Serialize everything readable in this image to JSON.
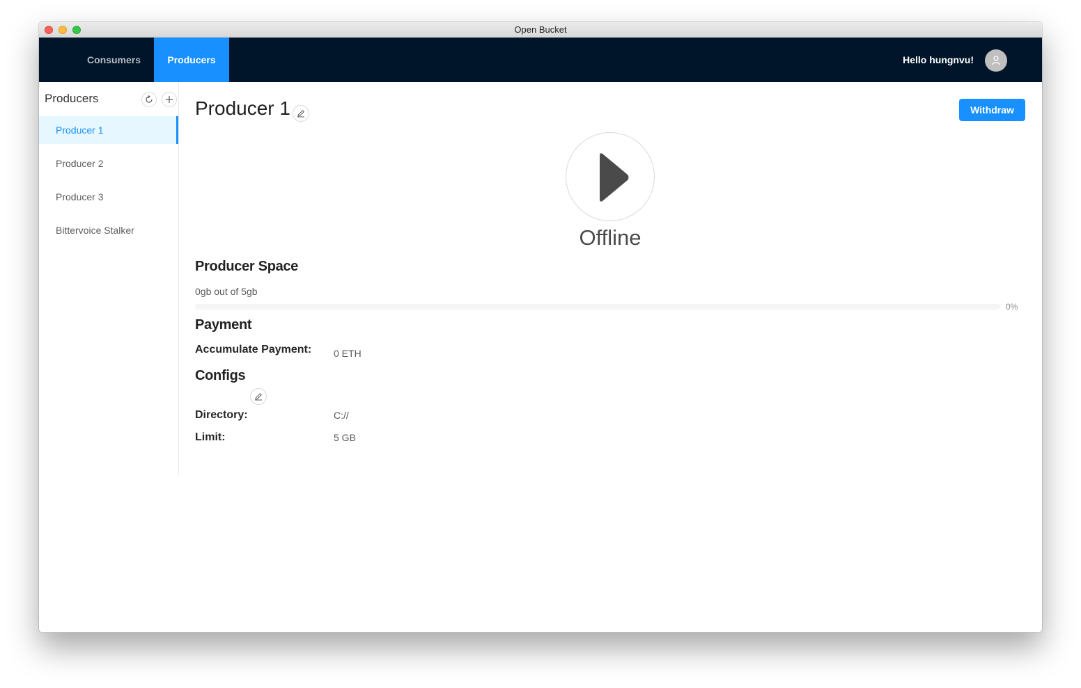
{
  "window": {
    "title": "Open Bucket"
  },
  "navbar": {
    "tabs": [
      {
        "label": "Consumers"
      },
      {
        "label": "Producers"
      }
    ],
    "greeting": "Hello hungnvu!"
  },
  "sidebar": {
    "title": "Producers",
    "items": [
      {
        "label": "Producer 1"
      },
      {
        "label": "Producer 2"
      },
      {
        "label": "Producer 3"
      },
      {
        "label": "Bittervoice Stalker"
      }
    ]
  },
  "main": {
    "title": "Producer 1",
    "withdraw_label": "Withdraw",
    "status": "Offline",
    "space": {
      "title": "Producer Space",
      "text": "0gb out of 5gb",
      "progress_percent": 0,
      "progress_label": "0%"
    },
    "payment": {
      "title": "Payment",
      "accumulate_label": "Accumulate Payment:",
      "accumulate_value": "0 ETH"
    },
    "configs": {
      "title": "Configs",
      "directory_label": "Directory:",
      "directory_value": "C://",
      "limit_label": "Limit:",
      "limit_value": "5 GB"
    }
  },
  "colors": {
    "navbar_bg": "#001529",
    "accent": "#1890ff"
  },
  "icons": {
    "refresh": "refresh-icon",
    "add": "plus-icon",
    "edit": "pencil-icon",
    "play": "play-icon",
    "avatar": "user-icon"
  }
}
